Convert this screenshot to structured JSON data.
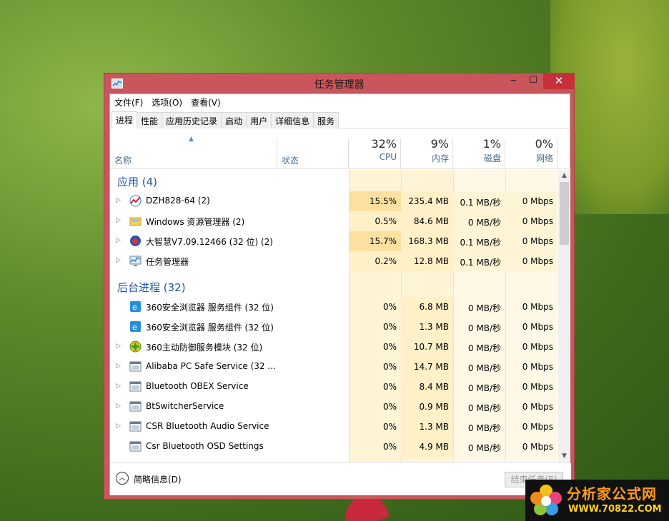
{
  "window": {
    "title": "任务管理器",
    "controls": {
      "minimize": "‒",
      "maximize": "☐",
      "close": "✕"
    }
  },
  "menu": [
    "文件(F)",
    "选项(O)",
    "查看(V)"
  ],
  "tabs": [
    "进程",
    "性能",
    "应用历史记录",
    "启动",
    "用户",
    "详细信息",
    "服务"
  ],
  "active_tab": "进程",
  "columns": {
    "name": "名称",
    "status": "状态",
    "cpu": {
      "pct": "32%",
      "label": "CPU"
    },
    "memory": {
      "pct": "9%",
      "label": "内存"
    },
    "disk": {
      "pct": "1%",
      "label": "磁盘"
    },
    "network": {
      "pct": "0%",
      "label": "网络"
    }
  },
  "groups": [
    {
      "title": "应用 (4)",
      "rows": [
        {
          "name": "DZH828-64 (2)",
          "icon": "dzh-icon",
          "expand": true,
          "cpu": "15.5%",
          "mem": "235.4 MB",
          "disk": "0.1 MB/秒",
          "net": "0 Mbps"
        },
        {
          "name": "Windows 资源管理器 (2)",
          "icon": "explorer-icon",
          "expand": true,
          "cpu": "0.5%",
          "mem": "84.6 MB",
          "disk": "0 MB/秒",
          "net": "0 Mbps"
        },
        {
          "name": "大智慧V7.09.12466 (32 位) (2)",
          "icon": "dazhihui-icon",
          "expand": true,
          "cpu": "15.7%",
          "mem": "168.3 MB",
          "disk": "0.1 MB/秒",
          "net": "0 Mbps"
        },
        {
          "name": "任务管理器",
          "icon": "task-manager-icon",
          "expand": true,
          "cpu": "0.2%",
          "mem": "12.8 MB",
          "disk": "0.1 MB/秒",
          "net": "0 Mbps"
        }
      ]
    },
    {
      "title": "后台进程 (32)",
      "rows": [
        {
          "name": "360安全浏览器 服务组件 (32 位)",
          "icon": "360-browser-icon",
          "expand": false,
          "cpu": "0%",
          "mem": "6.8 MB",
          "disk": "0 MB/秒",
          "net": "0 Mbps"
        },
        {
          "name": "360安全浏览器 服务组件 (32 位)",
          "icon": "360-browser-icon",
          "expand": false,
          "cpu": "0%",
          "mem": "1.3 MB",
          "disk": "0 MB/秒",
          "net": "0 Mbps"
        },
        {
          "name": "360主动防御服务模块 (32 位)",
          "icon": "360-defense-icon",
          "expand": true,
          "cpu": "0%",
          "mem": "10.7 MB",
          "disk": "0 MB/秒",
          "net": "0 Mbps"
        },
        {
          "name": "Alibaba PC Safe Service (32 ...",
          "icon": "service-icon",
          "expand": true,
          "cpu": "0%",
          "mem": "14.7 MB",
          "disk": "0 MB/秒",
          "net": "0 Mbps"
        },
        {
          "name": "Bluetooth OBEX Service",
          "icon": "service-icon",
          "expand": true,
          "cpu": "0%",
          "mem": "8.4 MB",
          "disk": "0 MB/秒",
          "net": "0 Mbps"
        },
        {
          "name": "BtSwitcherService",
          "icon": "service-icon",
          "expand": true,
          "cpu": "0%",
          "mem": "0.9 MB",
          "disk": "0 MB/秒",
          "net": "0 Mbps"
        },
        {
          "name": "CSR Bluetooth Audio Service",
          "icon": "service-icon",
          "expand": true,
          "cpu": "0%",
          "mem": "1.3 MB",
          "disk": "0 MB/秒",
          "net": "0 Mbps"
        },
        {
          "name": "Csr Bluetooth OSD Settings",
          "icon": "service-icon",
          "expand": false,
          "cpu": "0%",
          "mem": "4.9 MB",
          "disk": "0 MB/秒",
          "net": "0 Mbps"
        }
      ]
    }
  ],
  "footer": {
    "fewer_details": "简略信息(D)",
    "end_task": "结束任务(E)"
  },
  "watermark": {
    "title": "分析家公式网",
    "url": "WWW.70822.COM"
  },
  "colors": {
    "window_frame": "#c9565c",
    "close_button": "#c7303a",
    "heat_high": "#fde1a1",
    "heat_mid": "#fff0c8",
    "heat_low": "#fff4d6",
    "heat_lower": "#fff8e6",
    "group_title": "#1f56a8"
  }
}
